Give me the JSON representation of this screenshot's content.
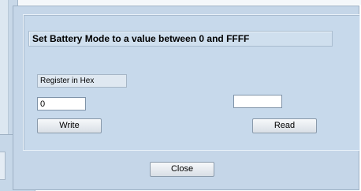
{
  "dialog": {
    "title": "Set Battery Mode to a value between 0 and  FFFF",
    "register_label": "Register in Hex",
    "write_input_value": "0",
    "read_output_value": "",
    "write_button": "Write",
    "read_button": "Read",
    "close_button": "Close"
  }
}
